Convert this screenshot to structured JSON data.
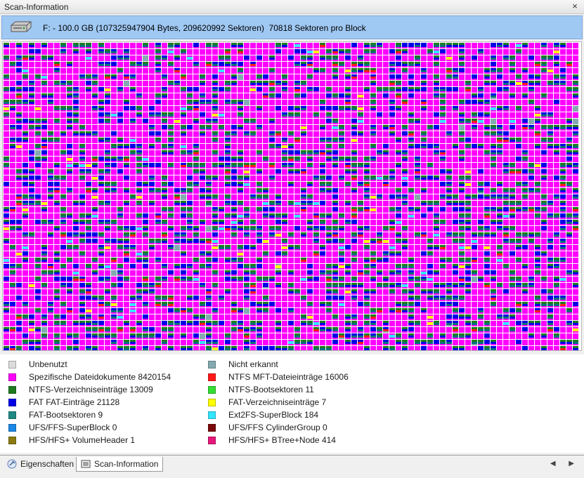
{
  "window": {
    "title": "Scan-Information",
    "close_label": "×"
  },
  "drive": {
    "icon": "harddisk-icon",
    "info": "F: - 100.0 GB (107325947904 Bytes, 209620992 Sektoren)  70818 Sektoren pro Block"
  },
  "block_map": {
    "colors": {
      "unused": "#dcdcdc",
      "specific": "#ff00ff",
      "ntfs_dir": "#1e7a1e",
      "fat": "#0000e6",
      "fat_boot": "#006f7a",
      "ntfs_mft": "#ff1a1a",
      "ext2": "#33e6ff",
      "yellow": "#ffff00",
      "not_recognized": "#84a9b0"
    }
  },
  "legend": [
    {
      "label": "Unbenutzt",
      "color": "#dcdcdc"
    },
    {
      "label": "Nicht erkannt",
      "color": "#84a9b0"
    },
    {
      "label": "Spezifische Dateidokumente 8420154",
      "color": "#ff00ff"
    },
    {
      "label": "NTFS MFT-Dateieinträge 16006",
      "color": "#ff1a1a"
    },
    {
      "label": "NTFS-Verzeichniseinträge 13009",
      "color": "#1e7a1e"
    },
    {
      "label": "NTFS-Bootsektoren 11",
      "color": "#33dd33"
    },
    {
      "label": "FAT FAT-Einträge 21128",
      "color": "#0000e6"
    },
    {
      "label": "FAT-Verzeichniseinträge 7",
      "color": "#ffff00"
    },
    {
      "label": "FAT-Bootsektoren 9",
      "color": "#1e8a82"
    },
    {
      "label": "Ext2FS-SuperBlock 184",
      "color": "#33e6ff"
    },
    {
      "label": "UFS/FFS-SuperBlock 0",
      "color": "#1a88e6"
    },
    {
      "label": "UFS/FFS CylinderGroup 0",
      "color": "#7a0a0a"
    },
    {
      "label": "HFS/HFS+ VolumeHeader 1",
      "color": "#8a7a10"
    },
    {
      "label": "HFS/HFS+ BTree+Node 414",
      "color": "#e6197a"
    }
  ],
  "tabs": [
    {
      "label": "Eigenschaften",
      "icon": "properties-icon"
    },
    {
      "label": "Scan-Information",
      "icon": "scan-info-icon"
    }
  ],
  "scroll_arrows": "◀ ▶"
}
